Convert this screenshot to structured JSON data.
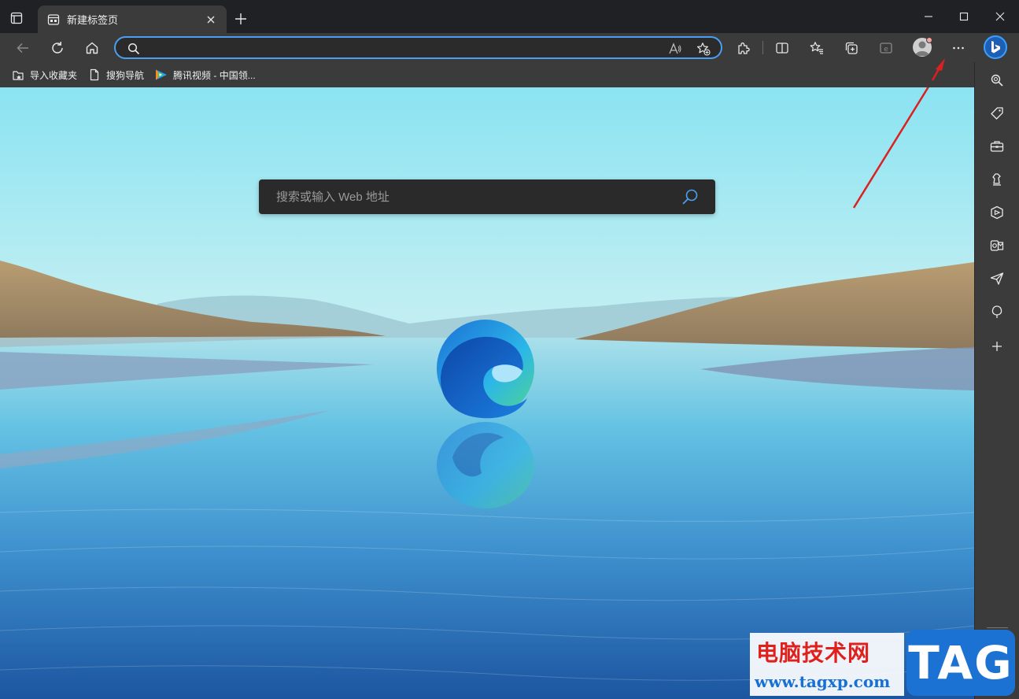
{
  "tab": {
    "title": "新建标签页"
  },
  "address_bar": {
    "value": "",
    "placeholder": ""
  },
  "favorites_bar": {
    "items": [
      {
        "label": "导入收藏夹",
        "icon": "import-favorites-icon"
      },
      {
        "label": "搜狗导航",
        "icon": "page-icon"
      },
      {
        "label": "腾讯视频 - 中国领...",
        "icon": "tencent-video-icon"
      }
    ]
  },
  "new_tab_page": {
    "search_placeholder": "搜索或输入 Web 地址"
  },
  "sidebar": {
    "items": [
      "search-icon",
      "tag-icon",
      "toolbox-icon",
      "chess-icon",
      "office-icon",
      "outlook-icon",
      "send-icon",
      "tree-icon",
      "add-icon"
    ]
  },
  "watermark": {
    "site_name": "电脑技术网",
    "url": "www.tagxp.com",
    "logo": "TAG"
  },
  "colors": {
    "accent": "#4aa0f0",
    "chrome_dark": "#202124",
    "toolbar": "#3b3b3b",
    "annotation_arrow": "#d9221f"
  }
}
